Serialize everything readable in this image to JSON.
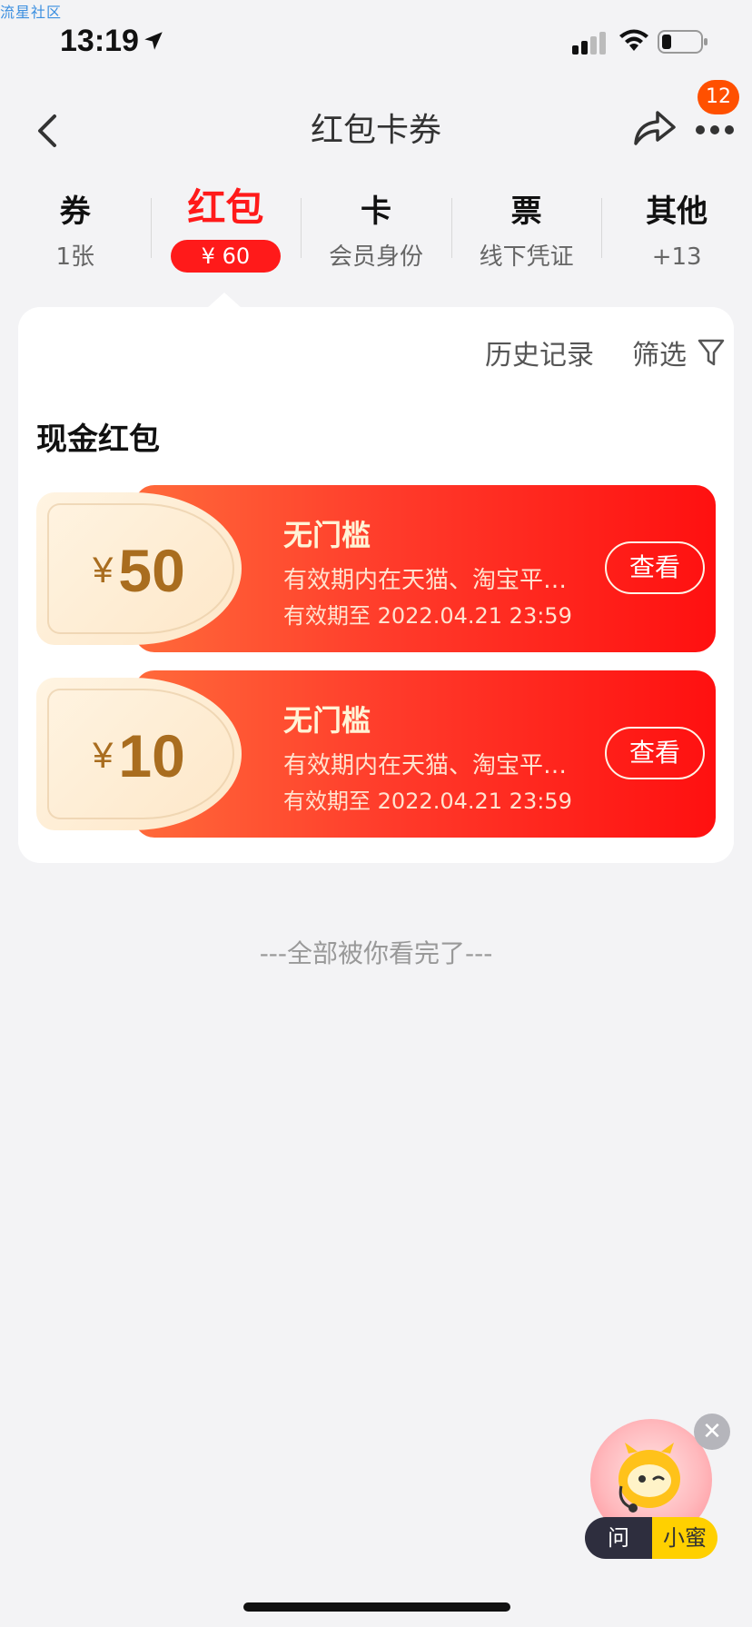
{
  "watermark": "流星社区",
  "status_bar": {
    "time": "13:19",
    "icons": [
      "location-arrow-icon",
      "cellular-signal-icon",
      "wifi-icon",
      "battery-icon"
    ]
  },
  "nav": {
    "title": "红包卡券",
    "badge_count": "12",
    "icons": [
      "back-icon",
      "share-icon",
      "more-icon"
    ]
  },
  "tabs": [
    {
      "title": "券",
      "sub": "1张",
      "active": false
    },
    {
      "title": "红包",
      "sub": "¥ 60",
      "active": true
    },
    {
      "title": "卡",
      "sub": "会员身份",
      "active": false
    },
    {
      "title": "票",
      "sub": "线下凭证",
      "active": false
    },
    {
      "title": "其他",
      "sub": "+13",
      "active": false
    }
  ],
  "panel": {
    "history_label": "历史记录",
    "filter_label": "筛选",
    "section_title": "现金红包",
    "coupons": [
      {
        "currency": "¥",
        "amount": "50",
        "title": "无门槛",
        "desc": "有效期内在天猫、淘宝平…",
        "expiry": "有效期至 2022.04.21 23:59",
        "button": "查看"
      },
      {
        "currency": "¥",
        "amount": "10",
        "title": "无门槛",
        "desc": "有效期内在天猫、淘宝平…",
        "expiry": "有效期至 2022.04.21 23:59",
        "button": "查看"
      }
    ]
  },
  "end_text": "---全部被你看完了---",
  "assistant": {
    "ask_label": "问",
    "name_label": "小蜜"
  },
  "colors": {
    "accent": "#ff1a1a",
    "badge": "#ff5000",
    "coupon_gold": "#a96d1f"
  }
}
